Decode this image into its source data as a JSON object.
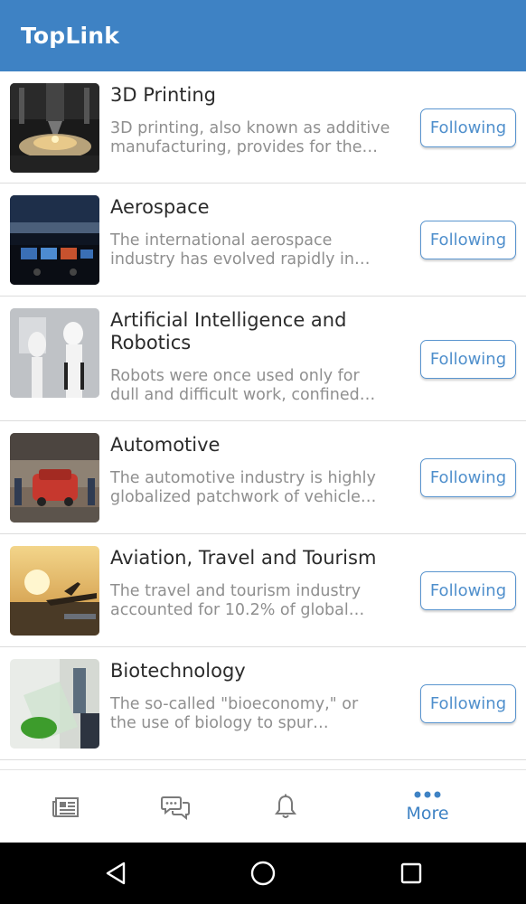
{
  "app": {
    "title": "TopLink",
    "accent_color": "#3e82c4"
  },
  "industries": [
    {
      "title": "3D Printing",
      "description": [
        "3D printing, also known as additive",
        "manufacturing, provides for the…"
      ],
      "status": "Following",
      "image": "3d-printer-nozzle-image"
    },
    {
      "title": "Aerospace",
      "description": [
        "The international aerospace",
        "industry has evolved rapidly in…"
      ],
      "status": "Following",
      "image": "cockpit-image"
    },
    {
      "title": "Artificial Intelligence and Robotics",
      "description": [
        "Robots were once used only for",
        "dull and difficult work, confined…"
      ],
      "status": "Following",
      "image": "robots-image"
    },
    {
      "title": "Automotive",
      "description": [
        "The automotive industry is highly",
        "globalized patchwork of vehicle…"
      ],
      "status": "Following",
      "image": "car-factory-image"
    },
    {
      "title": "Aviation, Travel and Tourism",
      "description": [
        "The travel and tourism industry",
        "accounted for 10.2% of global…"
      ],
      "status": "Following",
      "image": "airplane-sunset-image"
    },
    {
      "title": "Biotechnology",
      "description": [
        "The so-called \"bioeconomy,\" or",
        "the use of biology to spur…"
      ],
      "status": "Following",
      "image": "lab-flask-image"
    }
  ],
  "bottom_nav": {
    "items": [
      {
        "icon": "news-icon",
        "label": ""
      },
      {
        "icon": "chat-icon",
        "label": ""
      },
      {
        "icon": "bell-icon",
        "label": ""
      },
      {
        "icon": "more-dots-icon",
        "label": "More"
      }
    ]
  },
  "system_nav": {
    "items": [
      "back-icon",
      "home-icon",
      "recents-icon"
    ]
  }
}
